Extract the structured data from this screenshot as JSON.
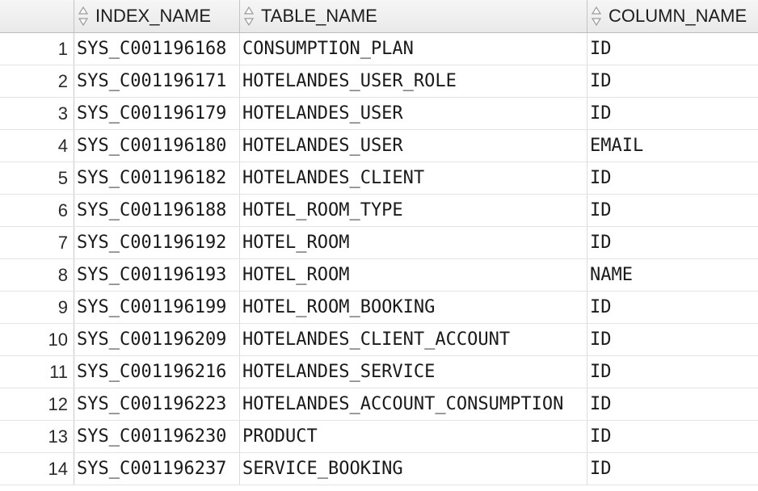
{
  "columns": [
    {
      "label": "INDEX_NAME",
      "icon": "sort-icon"
    },
    {
      "label": "TABLE_NAME",
      "icon": "sort-icon"
    },
    {
      "label": "COLUMN_NAME",
      "icon": "sort-icon"
    }
  ],
  "rows": [
    {
      "num": "1",
      "index_name": "SYS_C001196168",
      "table_name": "CONSUMPTION_PLAN",
      "column_name": "ID"
    },
    {
      "num": "2",
      "index_name": "SYS_C001196171",
      "table_name": "HOTELANDES_USER_ROLE",
      "column_name": "ID"
    },
    {
      "num": "3",
      "index_name": "SYS_C001196179",
      "table_name": "HOTELANDES_USER",
      "column_name": "ID"
    },
    {
      "num": "4",
      "index_name": "SYS_C001196180",
      "table_name": "HOTELANDES_USER",
      "column_name": "EMAIL"
    },
    {
      "num": "5",
      "index_name": "SYS_C001196182",
      "table_name": "HOTELANDES_CLIENT",
      "column_name": "ID"
    },
    {
      "num": "6",
      "index_name": "SYS_C001196188",
      "table_name": "HOTEL_ROOM_TYPE",
      "column_name": "ID"
    },
    {
      "num": "7",
      "index_name": "SYS_C001196192",
      "table_name": "HOTEL_ROOM",
      "column_name": "ID"
    },
    {
      "num": "8",
      "index_name": "SYS_C001196193",
      "table_name": "HOTEL_ROOM",
      "column_name": "NAME"
    },
    {
      "num": "9",
      "index_name": "SYS_C001196199",
      "table_name": "HOTEL_ROOM_BOOKING",
      "column_name": "ID"
    },
    {
      "num": "10",
      "index_name": "SYS_C001196209",
      "table_name": "HOTELANDES_CLIENT_ACCOUNT",
      "column_name": "ID"
    },
    {
      "num": "11",
      "index_name": "SYS_C001196216",
      "table_name": "HOTELANDES_SERVICE",
      "column_name": "ID"
    },
    {
      "num": "12",
      "index_name": "SYS_C001196223",
      "table_name": "HOTELANDES_ACCOUNT_CONSUMPTION",
      "column_name": "ID"
    },
    {
      "num": "13",
      "index_name": "SYS_C001196230",
      "table_name": "PRODUCT",
      "column_name": "ID"
    },
    {
      "num": "14",
      "index_name": "SYS_C001196237",
      "table_name": "SERVICE_BOOKING",
      "column_name": "ID"
    }
  ]
}
